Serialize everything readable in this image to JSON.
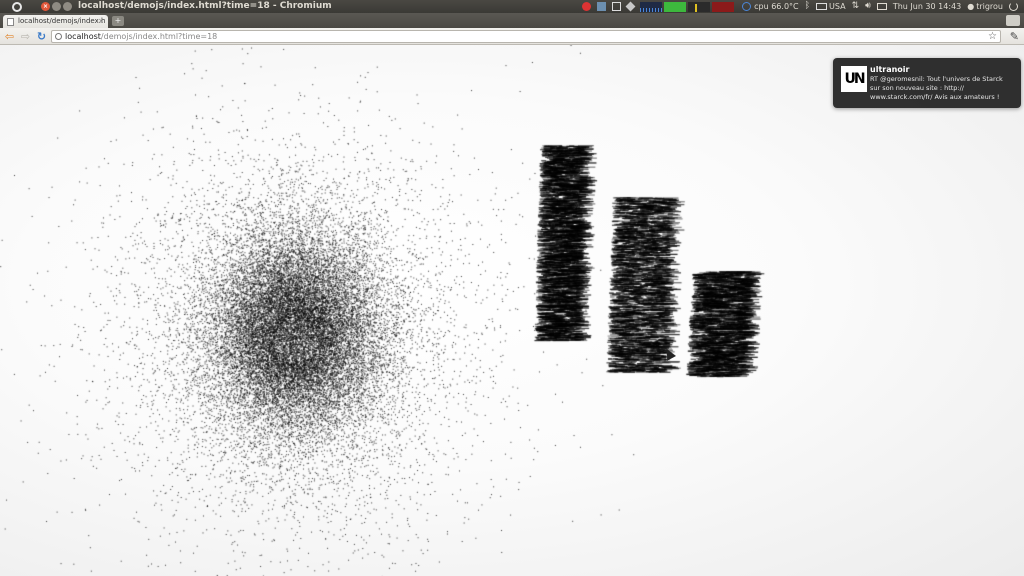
{
  "top_panel": {
    "window_title": "localhost/demojs/index.html?time=18 - Chromium",
    "cpu": "cpu 66.0°C",
    "keyboard_layout": "USA",
    "clock": "Thu Jun 30 14:43",
    "user": "trigrou"
  },
  "browser": {
    "tab_title": "localhost/demojs/index.h",
    "tab_close": "×",
    "new_tab": "+",
    "url_host": "localhost",
    "url_path": "/demojs/index.html?time=18",
    "back": "⇦",
    "forward": "⇨",
    "reload": "↻",
    "star": "☆",
    "wrench": "🔧"
  },
  "notification": {
    "avatar_text": "UN",
    "title": "ultranoir",
    "body": "RT @geromesnil: Tout l'univers de Starck sur son nouveau site : http:// www.starck.com/fr/ Avis aux amateurs !"
  },
  "colors": {
    "panel_bg": "#3c3b37",
    "close_button": "#e2573a",
    "particle": "#000000",
    "notification_bg": "#1e1e1e"
  }
}
